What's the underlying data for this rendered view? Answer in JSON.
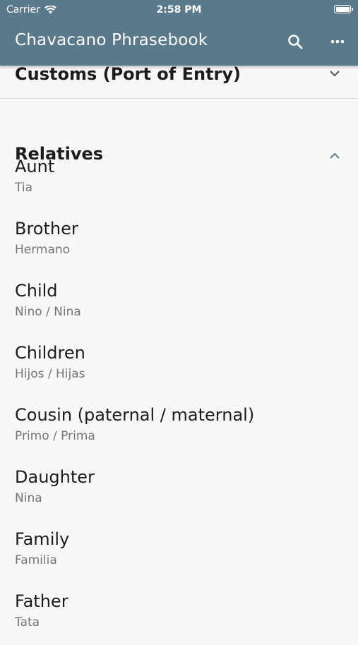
{
  "status_bar": {
    "carrier": "Carrier",
    "time": "2:58 PM"
  },
  "app_bar": {
    "title": "Chavacano Phrasebook",
    "search_icon": "search-icon",
    "more_icon": "more-horizontal-icon",
    "color": "#5a7a8c"
  },
  "sections": [
    {
      "title": "Customs (Port of Entry)",
      "expanded": false
    },
    {
      "title": "Relatives",
      "expanded": true
    }
  ],
  "items": [
    {
      "term": "Aunt",
      "translation": "Tia"
    },
    {
      "term": "Brother",
      "translation": "Hermano"
    },
    {
      "term": "Child",
      "translation": "Nino / Nina"
    },
    {
      "term": "Children",
      "translation": "Hijos / Hijas"
    },
    {
      "term": "Cousin (paternal / maternal)",
      "translation": "Primo / Prima"
    },
    {
      "term": "Daughter",
      "translation": "Nina"
    },
    {
      "term": "Family",
      "translation": "Familia"
    },
    {
      "term": "Father",
      "translation": "Tata"
    }
  ]
}
